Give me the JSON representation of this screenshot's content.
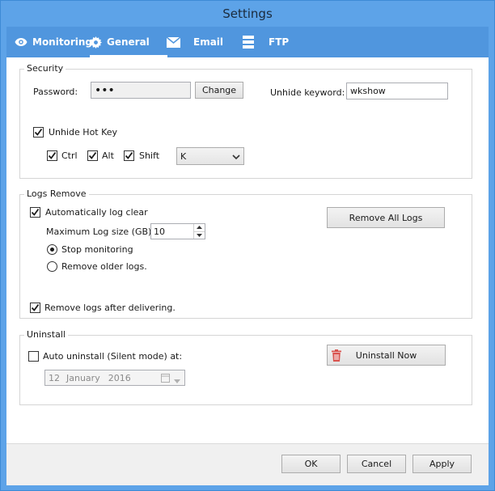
{
  "window": {
    "title": "Settings"
  },
  "tabs": [
    {
      "label": "Monitoring",
      "icon": "eye-icon"
    },
    {
      "label": "General",
      "icon": "gear-icon",
      "active": true
    },
    {
      "label": "Email",
      "icon": "envelope-icon"
    },
    {
      "label": "FTP",
      "icon": "server-icon"
    }
  ],
  "security": {
    "title": "Security",
    "password_label": "Password:",
    "password_value": "•••",
    "change_label": "Change",
    "unhide_keyword_label": "Unhide keyword:",
    "unhide_keyword_value": "wkshow",
    "unhide_hotkey_label": "Unhide Hot Key",
    "unhide_hotkey_checked": true,
    "ctrl_label": "Ctrl",
    "alt_label": "Alt",
    "shift_label": "Shift",
    "key_value": "K"
  },
  "logs": {
    "title": "Logs Remove",
    "auto_clear_label": "Automatically log clear",
    "max_size_label": "Maximum Log size (GB)",
    "max_size_value": "10",
    "stop_monitoring_label": "Stop monitoring",
    "remove_older_label": "Remove older logs.",
    "selected_option": "stop_monitoring",
    "remove_all_label": "Remove All Logs",
    "after_delivering_label": "Remove logs after delivering."
  },
  "uninstall": {
    "title": "Uninstall",
    "auto_uninstall_label": "Auto uninstall (Silent mode) at:",
    "auto_uninstall_checked": false,
    "date_day": "12",
    "date_month": "January",
    "date_year": "2016",
    "uninstall_now_label": "Uninstall Now"
  },
  "footer": {
    "ok_label": "OK",
    "cancel_label": "Cancel",
    "apply_label": "Apply"
  },
  "colors": {
    "title_bar": "#5da3e8",
    "tab_bar": "#5096de",
    "delete_icon": "#d9534f"
  }
}
